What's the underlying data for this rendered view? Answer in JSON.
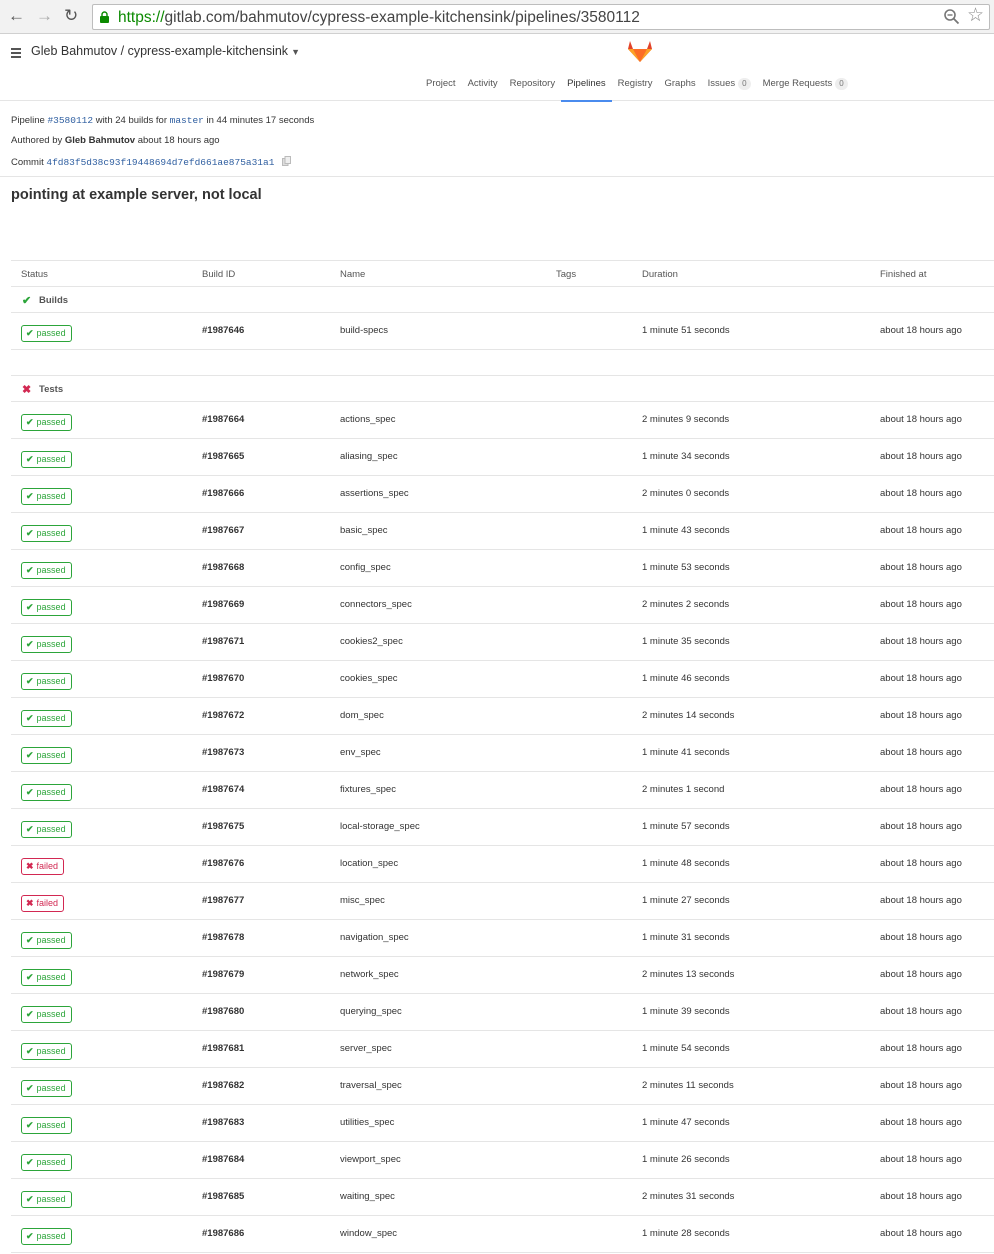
{
  "browser": {
    "url_scheme": "https://",
    "url_rest": "gitlab.com/bahmutov/cypress-example-kitchensink/pipelines/3580112"
  },
  "header": {
    "project_title": "Gleb Bahmutov / cypress-example-kitchensink",
    "tabs": [
      {
        "label": "Project"
      },
      {
        "label": "Activity"
      },
      {
        "label": "Repository"
      },
      {
        "label": "Pipelines",
        "active": true
      },
      {
        "label": "Registry"
      },
      {
        "label": "Graphs"
      },
      {
        "label": "Issues",
        "count": "0"
      },
      {
        "label": "Merge Requests",
        "count": "0"
      }
    ]
  },
  "pipeline": {
    "prefix": "Pipeline",
    "id": "#3580112",
    "with_text": "with 24 builds for",
    "branch": "master",
    "duration_text": "in 44 minutes 17 seconds",
    "authored_prefix": "Authored by",
    "author": "Gleb Bahmutov",
    "authored_time": "about 18 hours ago",
    "commit_prefix": "Commit",
    "commit_sha": "4fd83f5d38c93f19448694d7efd661ae875a31a1",
    "commit_title": "pointing at example server, not local"
  },
  "table": {
    "headers": {
      "status": "Status",
      "build_id": "Build ID",
      "name": "Name",
      "tags": "Tags",
      "duration": "Duration",
      "finished": "Finished at"
    },
    "stages": [
      {
        "name": "Builds",
        "status": "success",
        "jobs": [
          {
            "status": "passed",
            "id": "#1987646",
            "name": "build-specs",
            "duration": "1 minute 51 seconds",
            "finished": "about 18 hours ago"
          }
        ]
      },
      {
        "name": "Tests",
        "status": "failed",
        "jobs": [
          {
            "status": "passed",
            "id": "#1987664",
            "name": "actions_spec",
            "duration": "2 minutes 9 seconds",
            "finished": "about 18 hours ago"
          },
          {
            "status": "passed",
            "id": "#1987665",
            "name": "aliasing_spec",
            "duration": "1 minute 34 seconds",
            "finished": "about 18 hours ago"
          },
          {
            "status": "passed",
            "id": "#1987666",
            "name": "assertions_spec",
            "duration": "2 minutes 0 seconds",
            "finished": "about 18 hours ago"
          },
          {
            "status": "passed",
            "id": "#1987667",
            "name": "basic_spec",
            "duration": "1 minute 43 seconds",
            "finished": "about 18 hours ago"
          },
          {
            "status": "passed",
            "id": "#1987668",
            "name": "config_spec",
            "duration": "1 minute 53 seconds",
            "finished": "about 18 hours ago"
          },
          {
            "status": "passed",
            "id": "#1987669",
            "name": "connectors_spec",
            "duration": "2 minutes 2 seconds",
            "finished": "about 18 hours ago"
          },
          {
            "status": "passed",
            "id": "#1987671",
            "name": "cookies2_spec",
            "duration": "1 minute 35 seconds",
            "finished": "about 18 hours ago"
          },
          {
            "status": "passed",
            "id": "#1987670",
            "name": "cookies_spec",
            "duration": "1 minute 46 seconds",
            "finished": "about 18 hours ago"
          },
          {
            "status": "passed",
            "id": "#1987672",
            "name": "dom_spec",
            "duration": "2 minutes 14 seconds",
            "finished": "about 18 hours ago"
          },
          {
            "status": "passed",
            "id": "#1987673",
            "name": "env_spec",
            "duration": "1 minute 41 seconds",
            "finished": "about 18 hours ago"
          },
          {
            "status": "passed",
            "id": "#1987674",
            "name": "fixtures_spec",
            "duration": "2 minutes 1 second",
            "finished": "about 18 hours ago"
          },
          {
            "status": "passed",
            "id": "#1987675",
            "name": "local-storage_spec",
            "duration": "1 minute 57 seconds",
            "finished": "about 18 hours ago"
          },
          {
            "status": "failed",
            "id": "#1987676",
            "name": "location_spec",
            "duration": "1 minute 48 seconds",
            "finished": "about 18 hours ago"
          },
          {
            "status": "failed",
            "id": "#1987677",
            "name": "misc_spec",
            "duration": "1 minute 27 seconds",
            "finished": "about 18 hours ago"
          },
          {
            "status": "passed",
            "id": "#1987678",
            "name": "navigation_spec",
            "duration": "1 minute 31 seconds",
            "finished": "about 18 hours ago"
          },
          {
            "status": "passed",
            "id": "#1987679",
            "name": "network_spec",
            "duration": "2 minutes 13 seconds",
            "finished": "about 18 hours ago"
          },
          {
            "status": "passed",
            "id": "#1987680",
            "name": "querying_spec",
            "duration": "1 minute 39 seconds",
            "finished": "about 18 hours ago"
          },
          {
            "status": "passed",
            "id": "#1987681",
            "name": "server_spec",
            "duration": "1 minute 54 seconds",
            "finished": "about 18 hours ago"
          },
          {
            "status": "passed",
            "id": "#1987682",
            "name": "traversal_spec",
            "duration": "2 minutes 11 seconds",
            "finished": "about 18 hours ago"
          },
          {
            "status": "passed",
            "id": "#1987683",
            "name": "utilities_spec",
            "duration": "1 minute 47 seconds",
            "finished": "about 18 hours ago"
          },
          {
            "status": "passed",
            "id": "#1987684",
            "name": "viewport_spec",
            "duration": "1 minute 26 seconds",
            "finished": "about 18 hours ago"
          },
          {
            "status": "passed",
            "id": "#1987685",
            "name": "waiting_spec",
            "duration": "2 minutes 31 seconds",
            "finished": "about 18 hours ago"
          },
          {
            "status": "passed",
            "id": "#1987686",
            "name": "window_spec",
            "duration": "1 minute 28 seconds",
            "finished": "about 18 hours ago"
          }
        ]
      }
    ]
  },
  "colors": {
    "success": "#2ca53a",
    "failed": "#d22852",
    "link": "#2e5ea0",
    "active_tab": "#4a8bee"
  },
  "icons": {
    "back": "arrow-left-icon",
    "forward": "arrow-right-icon",
    "reload": "reload-icon",
    "lock": "lock-icon",
    "zoom": "zoom-icon",
    "bookmark": "star-icon",
    "menu": "hamburger-icon",
    "logo": "gitlab-fox-logo",
    "copy": "clipboard-icon",
    "passed": "check-icon",
    "failed": "x-icon"
  }
}
